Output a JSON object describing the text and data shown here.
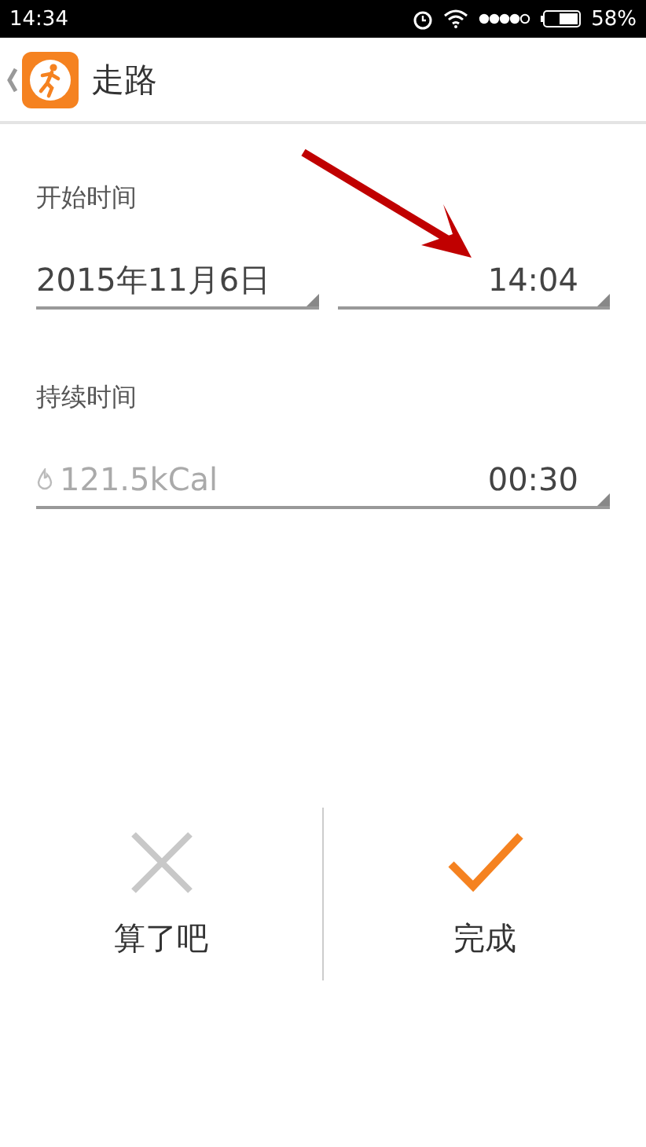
{
  "status_bar": {
    "time": "14:34",
    "battery": "58%"
  },
  "header": {
    "title": "走路"
  },
  "start": {
    "label": "开始时间",
    "date": "2015年11月6日",
    "time": "14:04"
  },
  "duration": {
    "label": "持续时间",
    "calories": "121.5kCal",
    "time": "00:30"
  },
  "actions": [
    {
      "label": "算了吧",
      "kind": "cancel"
    },
    {
      "label": "完成",
      "kind": "confirm"
    }
  ]
}
